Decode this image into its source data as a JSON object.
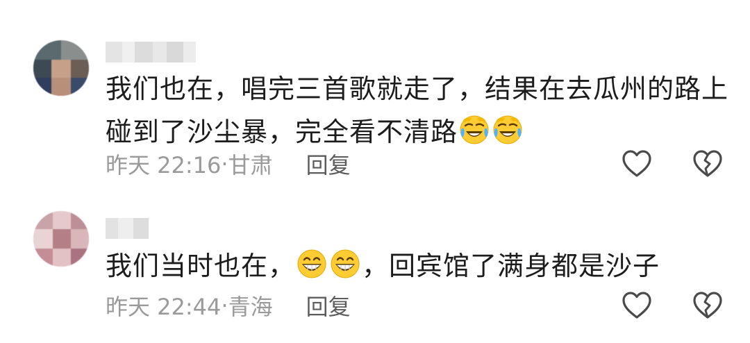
{
  "comments": [
    {
      "text_line1": "我们也在，唱完三首歌就走了，结果在去瓜州的路上",
      "text_line2": "碰到了沙尘暴，完全看不清路",
      "emojis": [
        "rolling-on-floor-laughing-icon",
        "rolling-on-floor-laughing-icon"
      ],
      "time": "昨天 22:16",
      "location": "甘肃",
      "reply_label": "回复"
    },
    {
      "text_before": "我们当时也在，",
      "emojis": [
        "grinning-face-icon",
        "grinning-face-icon"
      ],
      "text_after": "，回宾馆了满身都是沙子",
      "time": "昨天 22:44",
      "location": "青海",
      "reply_label": "回复"
    }
  ],
  "separator": "·",
  "icons": {
    "like": "heart-outline-icon",
    "dislike": "broken-heart-outline-icon"
  },
  "colors": {
    "text": "#1c1c1c",
    "meta": "#9a9a9a",
    "reply": "#5c5c5c",
    "icon": "#4a4a4a"
  }
}
